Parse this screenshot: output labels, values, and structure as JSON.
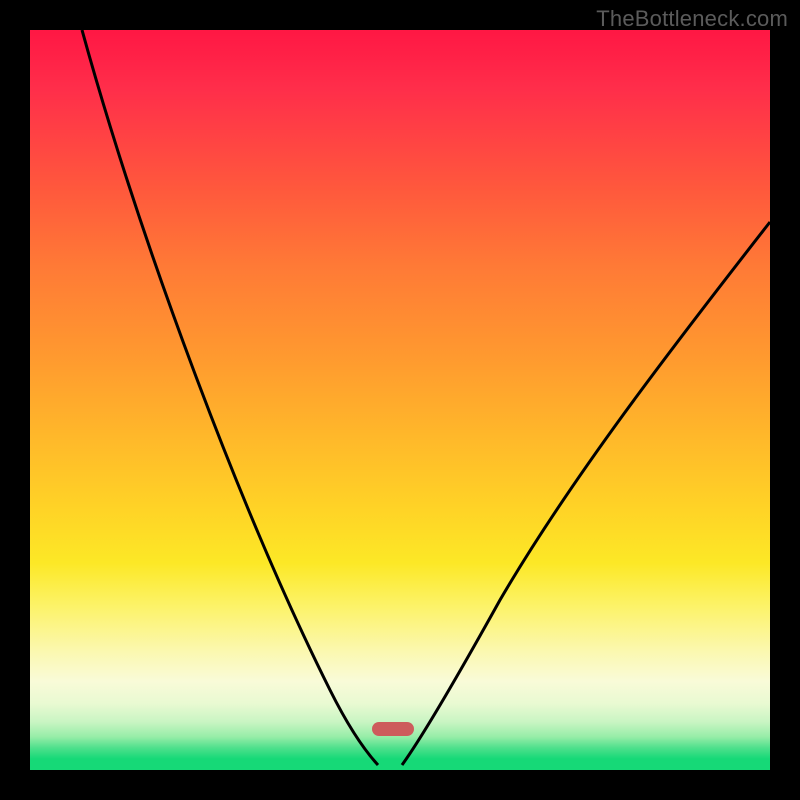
{
  "watermark_text": "TheBottleneck.com",
  "chart_data": {
    "type": "line",
    "title": "",
    "xlabel": "",
    "ylabel": "",
    "xlim": [
      0,
      100
    ],
    "ylim": [
      0,
      100
    ],
    "grid": false,
    "legend": false,
    "series": [
      {
        "name": "left-curve-bottleneck",
        "x": [
          7,
          10,
          14,
          18,
          22,
          26,
          30,
          34,
          38,
          42,
          44,
          46,
          47
        ],
        "y": [
          100,
          90,
          78,
          66,
          55,
          44,
          34,
          25,
          16,
          8,
          4,
          1.5,
          0.5
        ]
      },
      {
        "name": "right-curve-bottleneck",
        "x": [
          50,
          52,
          55,
          58,
          62,
          66,
          72,
          78,
          84,
          90,
          96,
          100
        ],
        "y": [
          0.5,
          3,
          8,
          14,
          22,
          30,
          40,
          49,
          57,
          64,
          70,
          74
        ]
      }
    ],
    "marker": {
      "name": "optimal-point",
      "x_center_pct": 48.5,
      "y_pct": 0.5,
      "color": "#cd5c5c"
    },
    "background_gradient": {
      "top": "#ff1744",
      "mid": "#ffd426",
      "bottom": "#16d977"
    }
  }
}
